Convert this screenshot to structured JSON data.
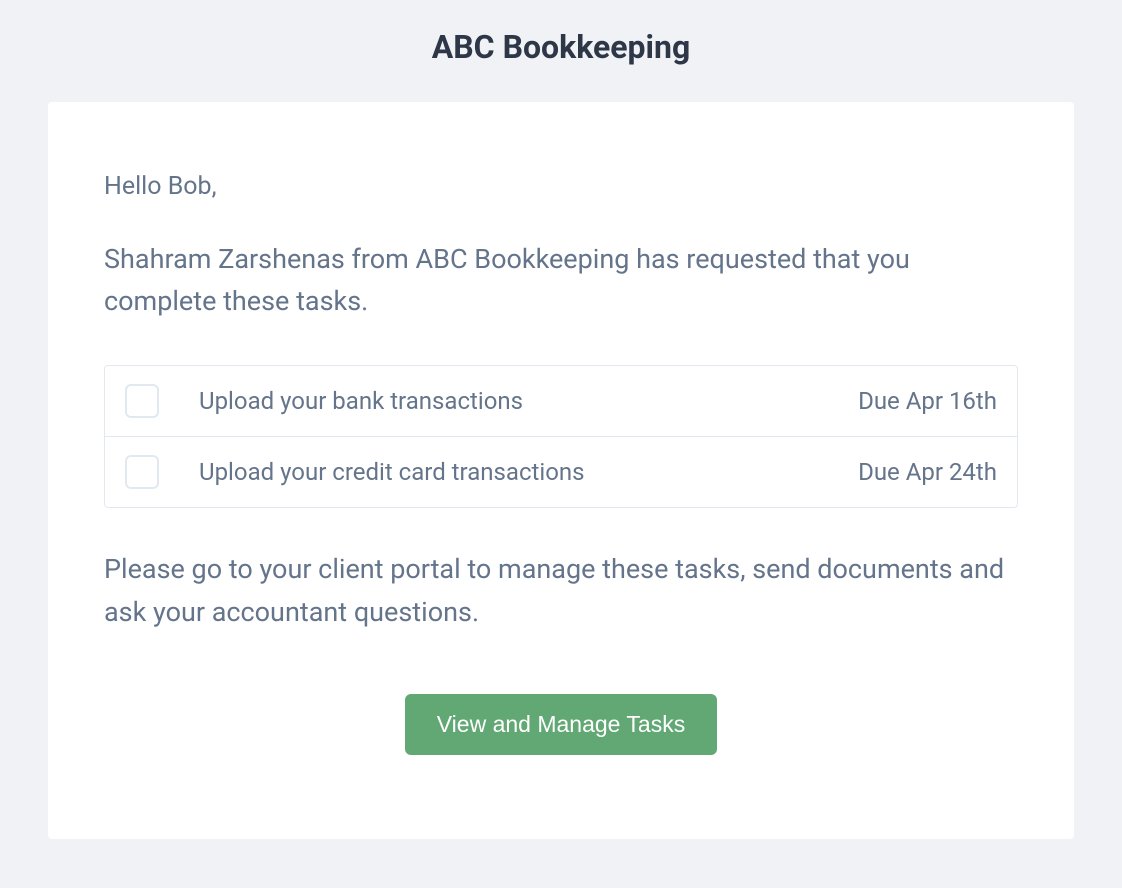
{
  "header": {
    "title": "ABC Bookkeeping"
  },
  "body": {
    "greeting": "Hello Bob,",
    "intro": "Shahram Zarshenas from ABC Bookkeeping has requested that you complete these tasks.",
    "tasks": [
      {
        "label": "Upload your bank transactions",
        "due": "Due Apr 16th"
      },
      {
        "label": "Upload your credit card transactions",
        "due": "Due Apr 24th"
      }
    ],
    "outro": "Please go to your client portal to manage these tasks, send documents and ask your accountant questions.",
    "cta_label": "View and Manage Tasks"
  }
}
